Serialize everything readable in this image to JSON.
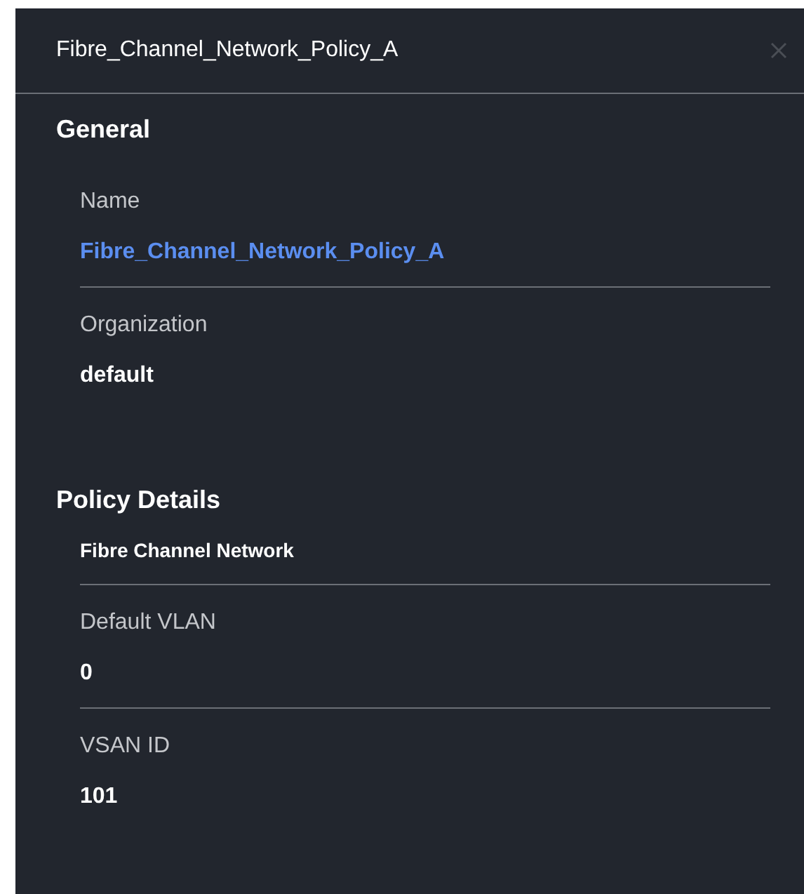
{
  "panel": {
    "title": "Fibre_Channel_Network_Policy_A"
  },
  "sections": [
    {
      "heading": "General",
      "items": [
        {
          "kind": "field",
          "label": "Name",
          "value": "Fibre_Channel_Network_Policy_A",
          "link": true,
          "divider": true
        },
        {
          "kind": "field",
          "label": "Organization",
          "value": "default",
          "link": false,
          "divider": false
        }
      ]
    },
    {
      "heading": "Policy Details",
      "items": [
        {
          "kind": "subheading",
          "text": "Fibre Channel Network",
          "divider": true
        },
        {
          "kind": "field",
          "label": "Default VLAN",
          "value": "0",
          "link": false,
          "divider": true
        },
        {
          "kind": "field",
          "label": "VSAN ID",
          "value": "101",
          "link": false,
          "divider": false
        }
      ]
    }
  ]
}
